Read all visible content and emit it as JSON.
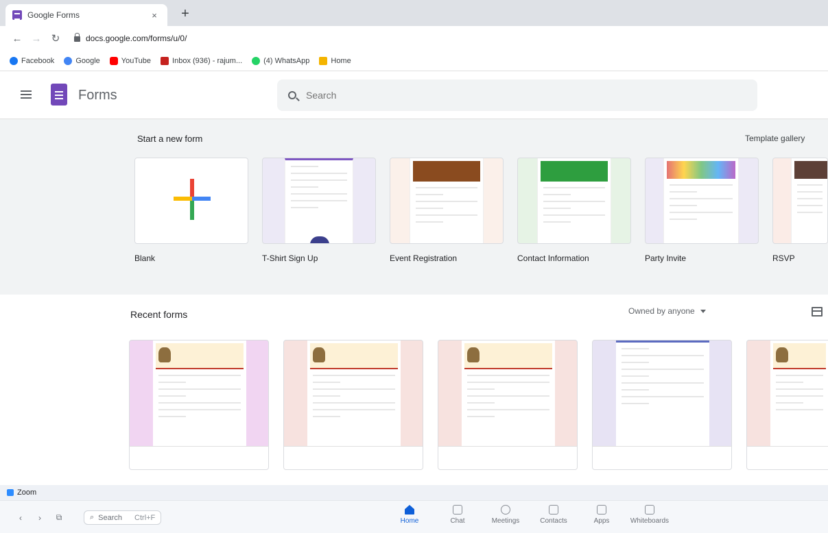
{
  "browser": {
    "tab_title": "Google Forms",
    "tab_close": "×",
    "new_tab": "+",
    "url": "docs.google.com/forms/u/0/",
    "bookmarks": [
      {
        "label": "Facebook",
        "color": "#1877f2"
      },
      {
        "label": "Google",
        "color": "#4285f4"
      },
      {
        "label": "YouTube",
        "color": "#ff0000"
      },
      {
        "label": "Inbox (936) - rajum...",
        "color": "#c5221f"
      },
      {
        "label": "(4) WhatsApp",
        "color": "#25d366"
      },
      {
        "label": "Home",
        "color": "#f4b400"
      }
    ]
  },
  "app": {
    "title": "Forms",
    "search_placeholder": "Search"
  },
  "start": {
    "heading": "Start a new form",
    "gallery_link": "Template gallery",
    "templates": [
      {
        "label": "Blank",
        "bg": "#ffffff"
      },
      {
        "label": "T-Shirt Sign Up",
        "bg": "#ece9f6"
      },
      {
        "label": "Event Registration",
        "bg": "#fbf0ea"
      },
      {
        "label": "Contact Information",
        "bg": "#e6f3e5"
      },
      {
        "label": "Party Invite",
        "bg": "#ece9f6"
      },
      {
        "label": "RSVP",
        "bg": "#fbece7"
      }
    ]
  },
  "recent": {
    "heading": "Recent forms",
    "owner_filter": "Owned by anyone",
    "cards": [
      {
        "bg": "#f1d5f2"
      },
      {
        "bg": "#f7e2df"
      },
      {
        "bg": "#f7e2df"
      },
      {
        "bg": "#e7e3f4"
      },
      {
        "bg": "#f7e2df"
      }
    ]
  },
  "zoom": {
    "app_name": "Zoom",
    "search_label": "Search",
    "search_shortcut": "Ctrl+F",
    "nav": [
      {
        "label": "Home",
        "active": true
      },
      {
        "label": "Chat",
        "active": false
      },
      {
        "label": "Meetings",
        "active": false
      },
      {
        "label": "Contacts",
        "active": false
      },
      {
        "label": "Apps",
        "active": false
      },
      {
        "label": "Whiteboards",
        "active": false
      }
    ]
  }
}
